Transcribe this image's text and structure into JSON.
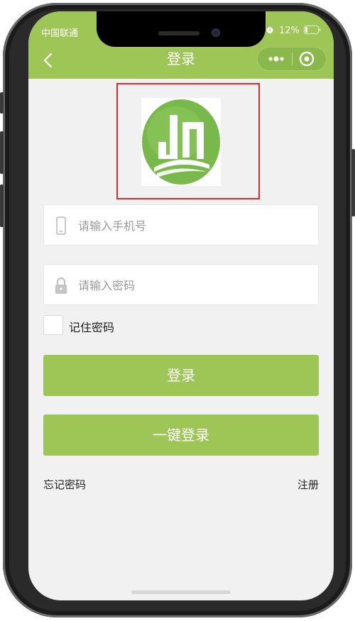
{
  "status_bar": {
    "carrier": "中国联通",
    "battery": "12%"
  },
  "nav": {
    "title": "登录",
    "back_icon": "chevron-left-icon",
    "more_icon": "more-dots-icon",
    "close_icon": "target-close-icon"
  },
  "logo": {
    "icon": "logo-jn-icon",
    "colors": {
      "circle": "#78b94a",
      "highlight": "#ffffff",
      "frame": "#e12a2a"
    }
  },
  "form": {
    "phone": {
      "placeholder": "请输入手机号",
      "icon": "phone-icon"
    },
    "password": {
      "placeholder": "请输入密码",
      "icon": "lock-icon"
    },
    "remember_label": "记住密码"
  },
  "buttons": {
    "login": "登录",
    "one_click_login": "一键登录"
  },
  "links": {
    "forgot_password": "忘记密码",
    "register": "注册"
  },
  "theme": {
    "accent": "#9dc656",
    "background": "#f1f1f1"
  }
}
